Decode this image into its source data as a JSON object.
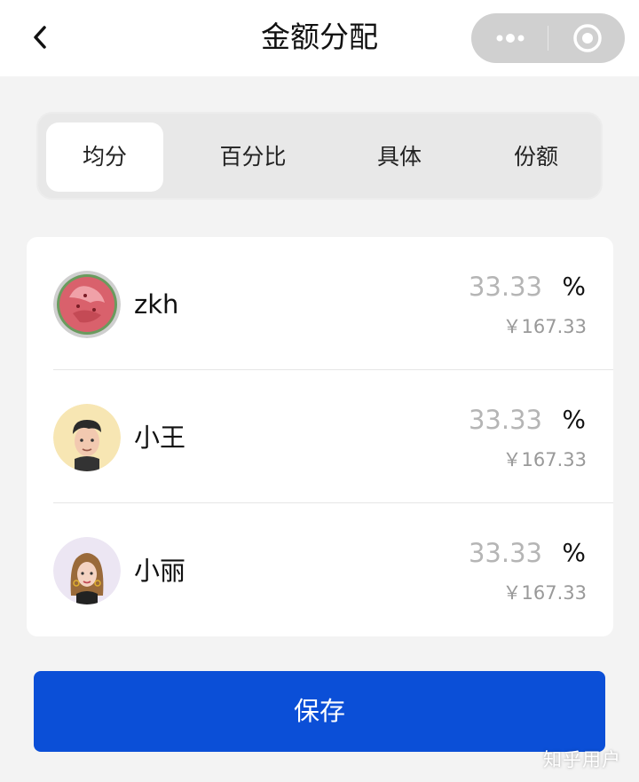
{
  "nav": {
    "title": "金额分配",
    "back_icon": "chevron-left-icon",
    "more_icon": "more-dots-icon",
    "close_icon": "target-close-icon"
  },
  "tabs": [
    {
      "label": "均分",
      "active": true
    },
    {
      "label": "百分比",
      "active": false
    },
    {
      "label": "具体",
      "active": false
    },
    {
      "label": "份额",
      "active": false
    }
  ],
  "members": [
    {
      "name": "zkh",
      "percent": "33.33",
      "unit": "%",
      "amount": "￥167.33",
      "avatar_icon": "watermelon-avatar"
    },
    {
      "name": "小王",
      "percent": "33.33",
      "unit": "%",
      "amount": "￥167.33",
      "avatar_icon": "man-avatar"
    },
    {
      "name": "小丽",
      "percent": "33.33",
      "unit": "%",
      "amount": "￥167.33",
      "avatar_icon": "woman-avatar"
    }
  ],
  "save_label": "保存",
  "watermark": "知乎用户",
  "colors": {
    "primary": "#0b4fd7",
    "background": "#f3f3f3"
  }
}
